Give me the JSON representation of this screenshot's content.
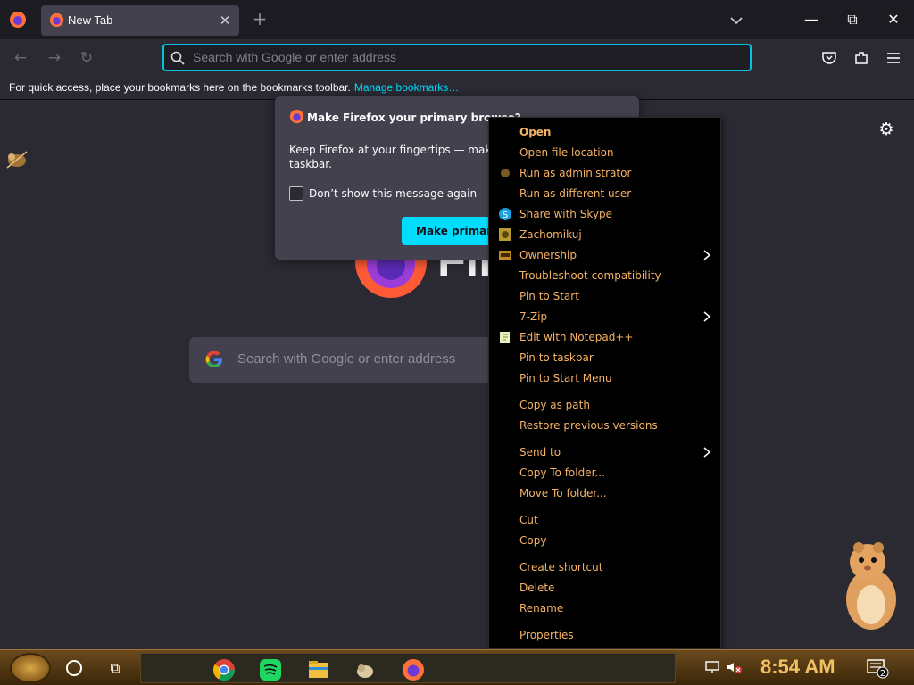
{
  "browser": {
    "tab": {
      "title": "New Tab",
      "close": "✕"
    },
    "new_tab": "+",
    "window": {
      "minimize": "—",
      "restore": "⧉",
      "close": "✕"
    }
  },
  "toolbar": {
    "url_placeholder": "Search with Google or enter address",
    "back": "←",
    "forward": "→",
    "reload": "↻"
  },
  "bookmarks_bar": {
    "message": "For quick access, place your bookmarks here on the bookmarks toolbar.",
    "link": "Manage bookmarks…"
  },
  "newtab_page": {
    "wordmark": "Fire",
    "search_placeholder": "Search with Google or enter address"
  },
  "dialog": {
    "title": "Make Firefox your primary browse?",
    "body": "Keep Firefox at your fingertips — make and pin it to your taskbar.",
    "checkbox_label": "Don’t show this message again",
    "primary_button": "Make primary"
  },
  "context_menu": {
    "groups": [
      [
        {
          "label": "Open",
          "bold": true,
          "icon": ""
        },
        {
          "label": "Open file location",
          "icon": ""
        },
        {
          "label": "Run as administrator",
          "icon": "shield-icon"
        },
        {
          "label": "Run as different user",
          "icon": ""
        },
        {
          "label": "Share with Skype",
          "icon": "skype-icon"
        },
        {
          "label": "Zachomikuj",
          "icon": "chomikuj-icon"
        },
        {
          "label": "Ownership",
          "icon": "ownership-icon",
          "submenu": true
        },
        {
          "label": "Troubleshoot compatibility",
          "icon": ""
        },
        {
          "label": "Pin to Start",
          "icon": ""
        },
        {
          "label": "7-Zip",
          "icon": "",
          "submenu": true
        },
        {
          "label": "Edit with Notepad++",
          "icon": "notepadpp-icon"
        },
        {
          "label": "Pin to taskbar",
          "icon": ""
        },
        {
          "label": "Pin to Start Menu",
          "icon": ""
        }
      ],
      [
        {
          "label": "Copy as path",
          "icon": ""
        },
        {
          "label": "Restore previous versions",
          "icon": ""
        }
      ],
      [
        {
          "label": "Send to",
          "icon": "",
          "submenu": true
        },
        {
          "label": "Copy To folder...",
          "icon": ""
        },
        {
          "label": "Move To folder...",
          "icon": ""
        }
      ],
      [
        {
          "label": "Cut",
          "icon": ""
        },
        {
          "label": "Copy",
          "icon": ""
        }
      ],
      [
        {
          "label": "Create shortcut",
          "icon": ""
        },
        {
          "label": "Delete",
          "icon": ""
        },
        {
          "label": "Rename",
          "icon": ""
        }
      ],
      [
        {
          "label": "Properties",
          "icon": ""
        }
      ]
    ]
  },
  "taskbar": {
    "task_view": "⧉",
    "apps": [
      "chrome-icon",
      "spotify-icon",
      "file-explorer-icon",
      "pet-icon",
      "firefox-icon"
    ],
    "clock": "8:54 AM",
    "notification_count": "2"
  },
  "colors": {
    "accent": "#00ddff",
    "menu_text": "#f5b266",
    "page_bg": "#2b2a33",
    "taskbar": "#6b4a1e"
  }
}
